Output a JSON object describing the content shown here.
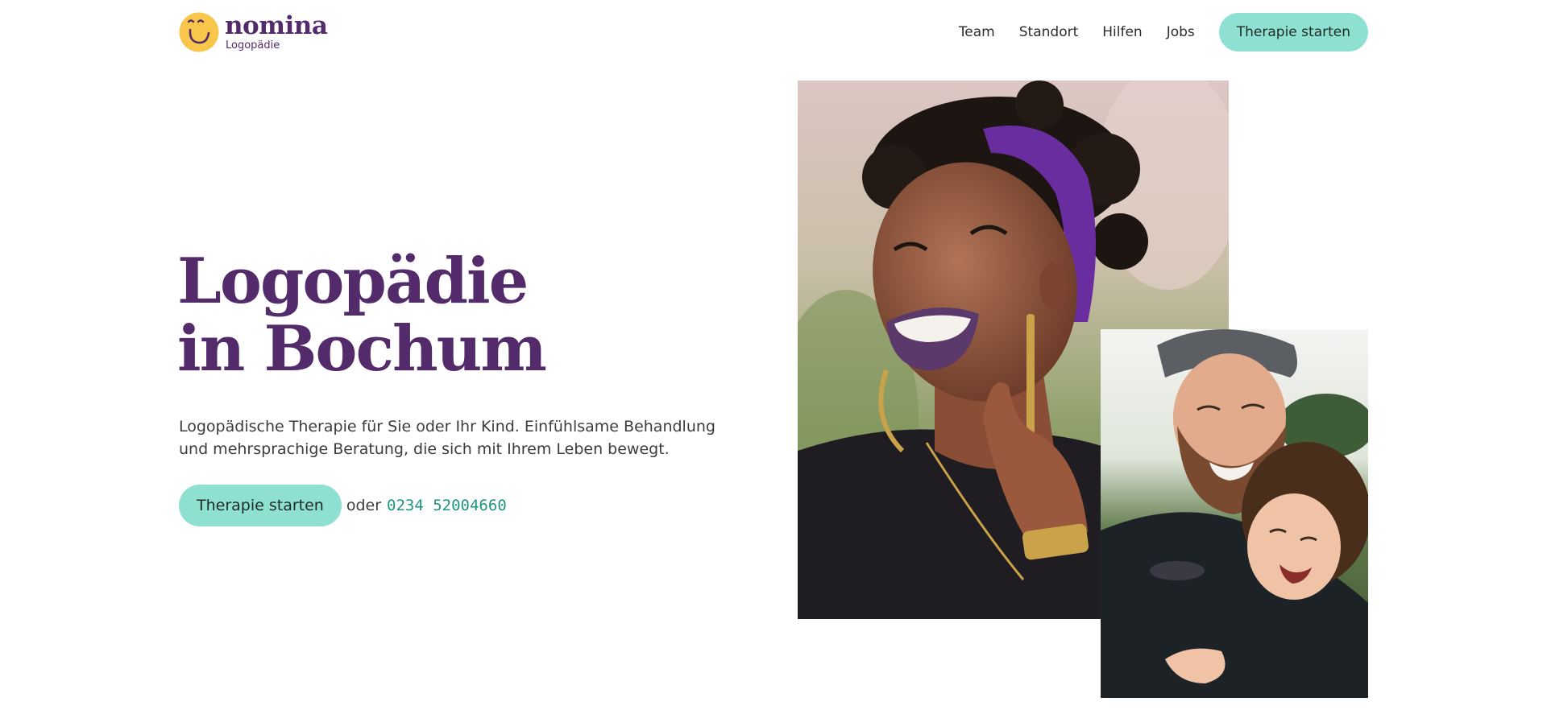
{
  "brand": {
    "name": "nomina",
    "subtitle": "Logopädie",
    "logo_icon": "smiley-face-icon",
    "colors": {
      "primary": "#532b6b",
      "accent": "#8ee0d0",
      "logo_yellow": "#f7c64a",
      "phone_link": "#1f9580"
    }
  },
  "nav": {
    "items": [
      {
        "label": "Team"
      },
      {
        "label": "Standort"
      },
      {
        "label": "Hilfen"
      },
      {
        "label": "Jobs"
      }
    ],
    "cta_label": "Therapie starten"
  },
  "hero": {
    "title_line1": "Logopädie",
    "title_line2": "in Bochum",
    "lead": "Logopädische Therapie für Sie oder Ihr Kind. Einfühlsame Behandlung und mehrsprachige Beratung, die sich mit Ihrem Leben bewegt.",
    "cta_label": "Therapie starten",
    "or_text": "oder",
    "phone": "0234 52004660"
  }
}
